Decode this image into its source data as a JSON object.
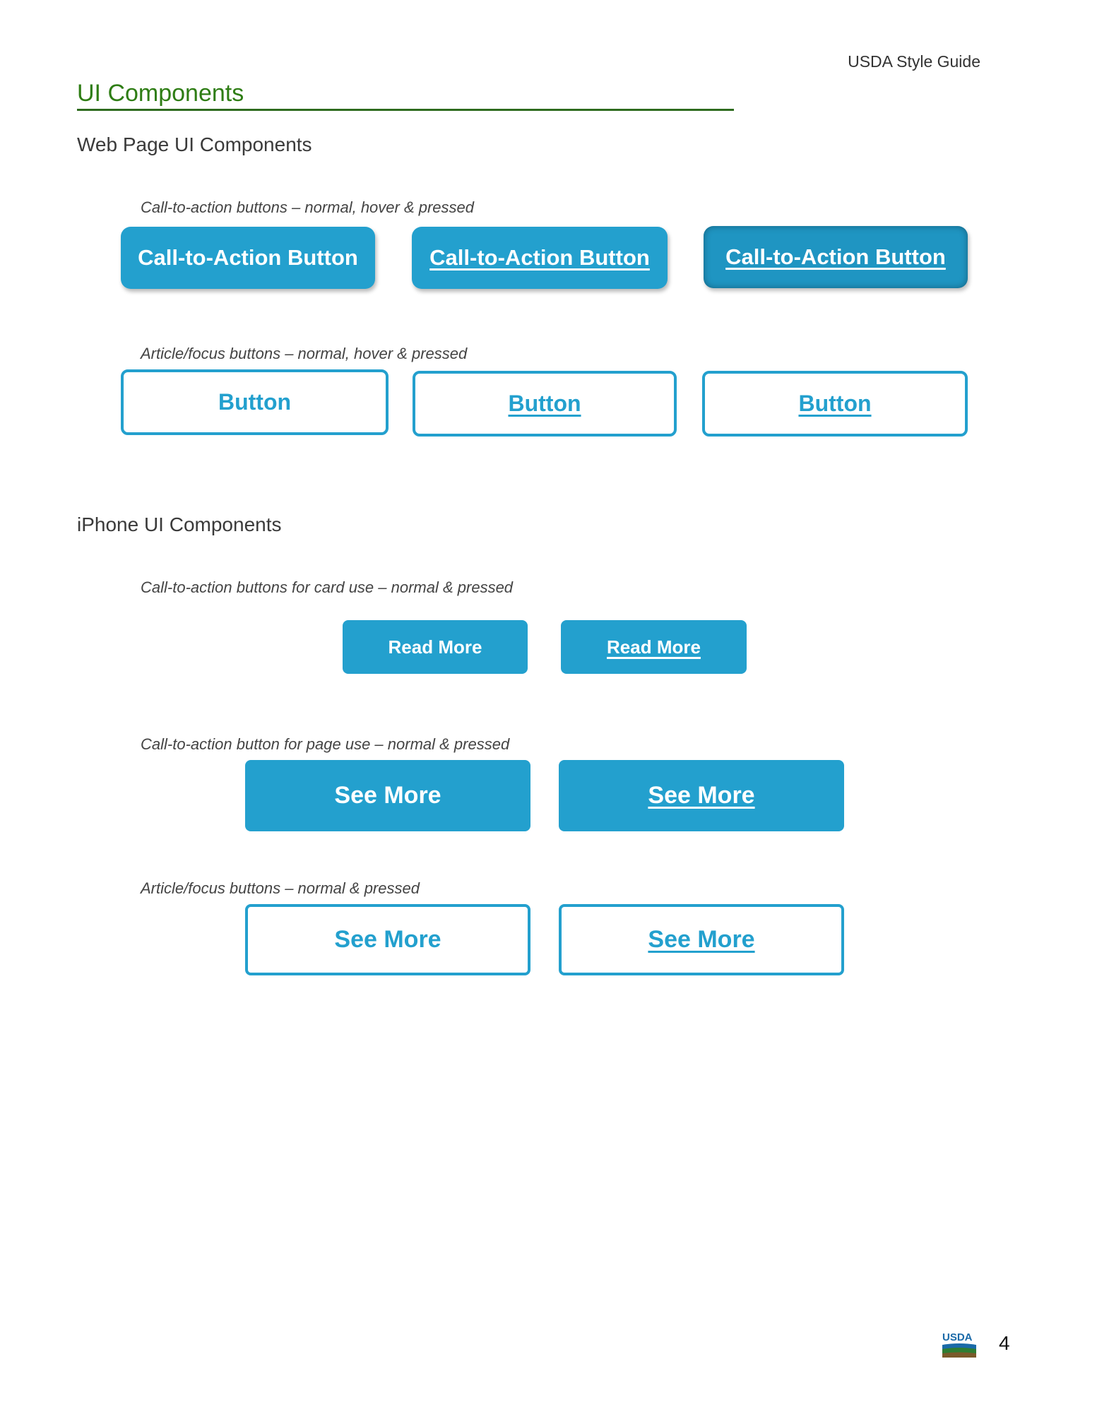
{
  "header": {
    "doc_title": "USDA Style Guide"
  },
  "page": {
    "title": "UI Components",
    "number": "4"
  },
  "web": {
    "heading": "Web Page UI Components",
    "cta_caption": "Call-to-action buttons – normal, hover & pressed",
    "cta_buttons": [
      "Call-to-Action Button",
      "Call-to-Action Button",
      "Call-to-Action Button"
    ],
    "article_caption": "Article/focus buttons – normal, hover & pressed",
    "article_buttons": [
      "Button",
      "Button",
      "Button"
    ]
  },
  "iphone": {
    "heading": "iPhone UI Components",
    "card_caption": "Call-to-action buttons for card use – normal & pressed",
    "card_buttons": [
      "Read More",
      "Read More"
    ],
    "page_caption": "Call-to-action button for page use – normal & pressed",
    "page_buttons": [
      "See More",
      "See More"
    ],
    "article_caption": "Article/focus buttons – normal & pressed",
    "article_buttons": [
      "See More",
      "See More"
    ]
  },
  "footer": {
    "logo_text": "USDA"
  },
  "colors": {
    "accent": "#23a0ce",
    "title_green": "#2e7d14",
    "rule_green": "#2e6b1e"
  }
}
